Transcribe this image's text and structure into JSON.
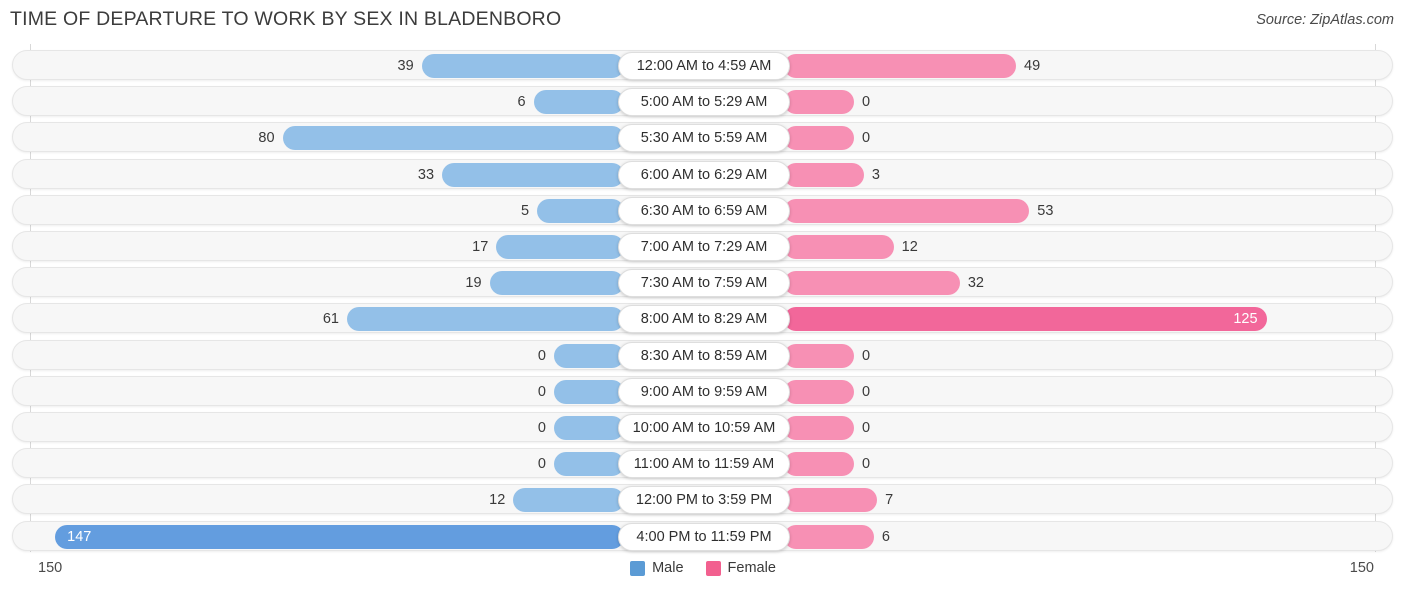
{
  "header": {
    "title": "TIME OF DEPARTURE TO WORK BY SEX IN BLADENBORO",
    "source": "Source: ZipAtlas.com"
  },
  "axis": {
    "left_max": "150",
    "right_max": "150"
  },
  "legend": {
    "male_label": "Male",
    "female_label": "Female",
    "male_color": "#5b9bd5",
    "female_color": "#f2608f"
  },
  "colors": {
    "male_bar": "#93c0e8",
    "male_bar_max": "#639ddf",
    "female_bar": "#f790b4",
    "female_bar_max": "#f2679a",
    "track": "#f7f7f7",
    "pill": "#ffffff"
  },
  "chart_data": {
    "type": "bar",
    "title": "TIME OF DEPARTURE TO WORK BY SEX IN BLADENBORO",
    "subtitle": "",
    "xlabel": "",
    "ylabel": "",
    "orientation": "horizontal-diverging",
    "axis_max": 150,
    "xlim": [
      150,
      150
    ],
    "grid": false,
    "legend_position": "bottom-center",
    "categories": [
      "12:00 AM to 4:59 AM",
      "5:00 AM to 5:29 AM",
      "5:30 AM to 5:59 AM",
      "6:00 AM to 6:29 AM",
      "6:30 AM to 6:59 AM",
      "7:00 AM to 7:29 AM",
      "7:30 AM to 7:59 AM",
      "8:00 AM to 8:29 AM",
      "8:30 AM to 8:59 AM",
      "9:00 AM to 9:59 AM",
      "10:00 AM to 10:59 AM",
      "11:00 AM to 11:59 AM",
      "12:00 PM to 3:59 PM",
      "4:00 PM to 11:59 PM"
    ],
    "series": [
      {
        "name": "Male",
        "values": [
          39,
          6,
          80,
          33,
          5,
          17,
          19,
          61,
          0,
          0,
          0,
          0,
          12,
          147
        ]
      },
      {
        "name": "Female",
        "values": [
          49,
          0,
          0,
          3,
          53,
          12,
          32,
          125,
          0,
          0,
          0,
          0,
          7,
          6
        ]
      }
    ]
  },
  "rows": [
    {
      "label": "12:00 AM to 4:59 AM",
      "male": "39",
      "female": "49"
    },
    {
      "label": "5:00 AM to 5:29 AM",
      "male": "6",
      "female": "0"
    },
    {
      "label": "5:30 AM to 5:59 AM",
      "male": "80",
      "female": "0"
    },
    {
      "label": "6:00 AM to 6:29 AM",
      "male": "33",
      "female": "3"
    },
    {
      "label": "6:30 AM to 6:59 AM",
      "male": "5",
      "female": "53"
    },
    {
      "label": "7:00 AM to 7:29 AM",
      "male": "17",
      "female": "12"
    },
    {
      "label": "7:30 AM to 7:59 AM",
      "male": "19",
      "female": "32"
    },
    {
      "label": "8:00 AM to 8:29 AM",
      "male": "61",
      "female": "125"
    },
    {
      "label": "8:30 AM to 8:59 AM",
      "male": "0",
      "female": "0"
    },
    {
      "label": "9:00 AM to 9:59 AM",
      "male": "0",
      "female": "0"
    },
    {
      "label": "10:00 AM to 10:59 AM",
      "male": "0",
      "female": "0"
    },
    {
      "label": "11:00 AM to 11:59 AM",
      "male": "0",
      "female": "0"
    },
    {
      "label": "12:00 PM to 3:59 PM",
      "male": "12",
      "female": "7"
    },
    {
      "label": "4:00 PM to 11:59 PM",
      "male": "147",
      "female": "6"
    }
  ]
}
